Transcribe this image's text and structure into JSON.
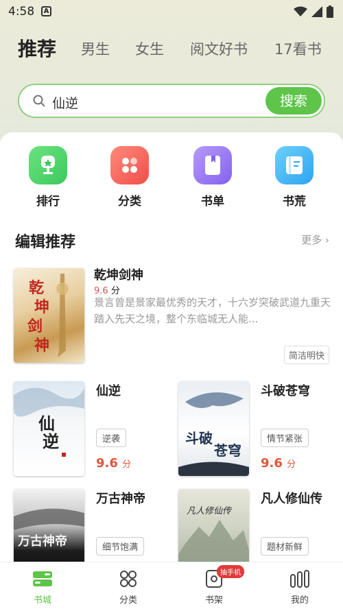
{
  "status": {
    "time": "4:58"
  },
  "tabs": [
    {
      "label": "推荐"
    },
    {
      "label": "男生"
    },
    {
      "label": "女生"
    },
    {
      "label": "阅文好书"
    },
    {
      "label": "17看书"
    }
  ],
  "search": {
    "value": "仙逆",
    "button": "搜索"
  },
  "categories": [
    {
      "label": "排行",
      "icon": "trophy-icon",
      "color": "#4cd36a"
    },
    {
      "label": "分类",
      "icon": "grid-icon",
      "color": "#f2605a"
    },
    {
      "label": "书单",
      "icon": "bookmark-book-icon",
      "color": "#9a7bf5"
    },
    {
      "label": "书荒",
      "icon": "book-icon",
      "color": "#3fb4f5"
    }
  ],
  "section": {
    "title": "编辑推荐",
    "more": "更多"
  },
  "featured": {
    "title": "乾坤剑神",
    "score": "9.6",
    "unit": "分",
    "description": "景言曾是景家最优秀的天才，十六岁突破武道九重天踏入先天之境，整个东临城无人能...",
    "tag": "简洁明快",
    "cover_text": "乾坤剑神"
  },
  "books": [
    {
      "title": "仙逆",
      "tag": "逆袭",
      "score": "9.6",
      "unit": "分",
      "cover_text": "仙逆"
    },
    {
      "title": "斗破苍穹",
      "tag": "情节紧张",
      "score": "9.6",
      "unit": "分",
      "cover_text": "斗破苍穹"
    },
    {
      "title": "万古神帝",
      "tag": "细节饱满",
      "cover_text": "万古神帝"
    },
    {
      "title": "凡人修仙传",
      "tag": "题材新鲜",
      "cover_text": "凡人修仙传"
    }
  ],
  "bottom_nav": [
    {
      "label": "书城",
      "icon": "bookstore-icon"
    },
    {
      "label": "分类",
      "icon": "category-icon"
    },
    {
      "label": "书架",
      "icon": "bookshelf-icon",
      "badge": "抽手机"
    },
    {
      "label": "我的",
      "icon": "profile-icon"
    }
  ],
  "colors": {
    "accent": "#5ec44a",
    "score": "#e0573a"
  }
}
